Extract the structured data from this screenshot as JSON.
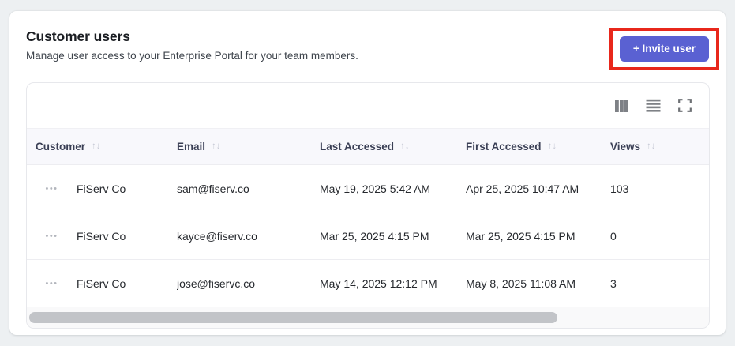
{
  "card": {
    "title": "Customer users",
    "subtitle": "Manage user access to your Enterprise Portal for your team members.",
    "invite_button_label": "+ Invite user"
  },
  "colors": {
    "accent": "#5a61d2",
    "annotation_red": "#e8271b",
    "header_bg": "#f8f8fc",
    "page_bg": "#edf0f2"
  },
  "toolbar": {
    "icons": [
      "columns-icon",
      "row-density-icon",
      "fullscreen-icon"
    ]
  },
  "table": {
    "sort_icon": "↑↓",
    "row_menu_icon": "•••",
    "columns": [
      {
        "label": "Customer"
      },
      {
        "label": "Email"
      },
      {
        "label": "Last Accessed"
      },
      {
        "label": "First Accessed"
      },
      {
        "label": "Views"
      }
    ],
    "rows": [
      {
        "customer": "FiServ Co",
        "email": "sam@fiserv.co",
        "last_accessed": "May 19, 2025 5:42 AM",
        "first_accessed": "Apr 25, 2025 10:47 AM",
        "views": "103"
      },
      {
        "customer": "FiServ Co",
        "email": "kayce@fiserv.co",
        "last_accessed": "Mar 25, 2025 4:15 PM",
        "first_accessed": "Mar 25, 2025 4:15 PM",
        "views": "0"
      },
      {
        "customer": "FiServ Co",
        "email": "jose@fiservc.co",
        "last_accessed": "May 14, 2025 12:12 PM",
        "first_accessed": "May 8, 2025 11:08 AM",
        "views": "3"
      }
    ],
    "scrollbar": {
      "thumb_percent": 78
    }
  }
}
